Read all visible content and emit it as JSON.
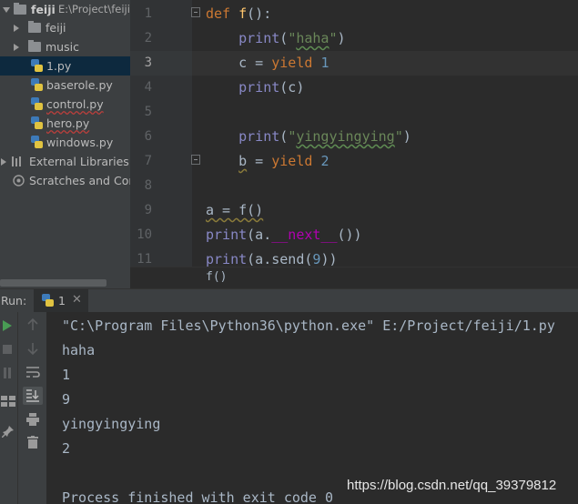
{
  "project": {
    "root": {
      "name": "feiji",
      "path": "E:\\Project\\feiji"
    },
    "items": [
      {
        "label": "feiji",
        "type": "folder"
      },
      {
        "label": "music",
        "type": "folder"
      },
      {
        "label": "1.py",
        "type": "file",
        "selected": true
      },
      {
        "label": "baserole.py",
        "type": "file"
      },
      {
        "label": "control.py",
        "type": "file"
      },
      {
        "label": "hero.py",
        "type": "file"
      },
      {
        "label": "windows.py",
        "type": "file"
      }
    ],
    "external_libraries": "External Libraries",
    "scratches": "Scratches and Consoles"
  },
  "editor": {
    "line_numbers": [
      "1",
      "2",
      "3",
      "4",
      "5",
      "6",
      "7",
      "8",
      "9",
      "10",
      "11"
    ],
    "current_line": "3",
    "lines": [
      {
        "t": [
          [
            "def",
            "kw"
          ],
          [
            " ",
            ""
          ],
          [
            "f",
            "fn"
          ],
          [
            "():",
            ""
          ]
        ]
      },
      {
        "t": [
          [
            "    ",
            ""
          ],
          [
            "print",
            "bi"
          ],
          [
            "(",
            ""
          ],
          [
            "\"",
            "str"
          ],
          [
            "haha",
            "str wavy-g"
          ],
          [
            "\"",
            "str"
          ],
          [
            ")",
            ""
          ]
        ]
      },
      {
        "t": [
          [
            "    c = ",
            ""
          ],
          [
            "yield",
            "kw"
          ],
          [
            " ",
            ""
          ],
          [
            "1",
            "num"
          ]
        ]
      },
      {
        "t": [
          [
            "    ",
            ""
          ],
          [
            "print",
            "bi"
          ],
          [
            "(c)",
            ""
          ]
        ]
      },
      {
        "t": []
      },
      {
        "t": [
          [
            "    ",
            ""
          ],
          [
            "print",
            "bi"
          ],
          [
            "(",
            ""
          ],
          [
            "\"",
            "str"
          ],
          [
            "yingyingying",
            "str wavy-g"
          ],
          [
            "\"",
            "str"
          ],
          [
            ")",
            ""
          ]
        ]
      },
      {
        "t": [
          [
            "    ",
            ""
          ],
          [
            "b",
            "wavy-y"
          ],
          [
            " = ",
            ""
          ],
          [
            "yield",
            "kw"
          ],
          [
            " ",
            ""
          ],
          [
            "2",
            "num"
          ]
        ]
      },
      {
        "t": []
      },
      {
        "t": [
          [
            "a = f()",
            "wavy-y"
          ]
        ]
      },
      {
        "t": [
          [
            "print",
            "bi"
          ],
          [
            "(a.",
            ""
          ],
          [
            "__next__",
            "dunder"
          ],
          [
            "())",
            ""
          ]
        ]
      },
      {
        "t": [
          [
            "print",
            "bi"
          ],
          [
            "(a.send(",
            ""
          ],
          [
            "9",
            "num"
          ],
          [
            "))",
            ""
          ]
        ]
      }
    ],
    "breadcrumb": "f()"
  },
  "run": {
    "label": "Run:",
    "tab": "1",
    "output": [
      "\"C:\\Program Files\\Python36\\python.exe\" E:/Project/feiji/1.py",
      "haha",
      "1",
      "9",
      "yingyingying",
      "2",
      "",
      "Process finished with exit code 0"
    ]
  },
  "watermark": "https://blog.csdn.net/qq_39379812",
  "colors": {
    "keyword": "#cc7832",
    "builtin": "#8888c6",
    "string": "#6a8759",
    "number": "#6897bb",
    "function": "#ffc66d",
    "selected_row": "#0d293e"
  }
}
